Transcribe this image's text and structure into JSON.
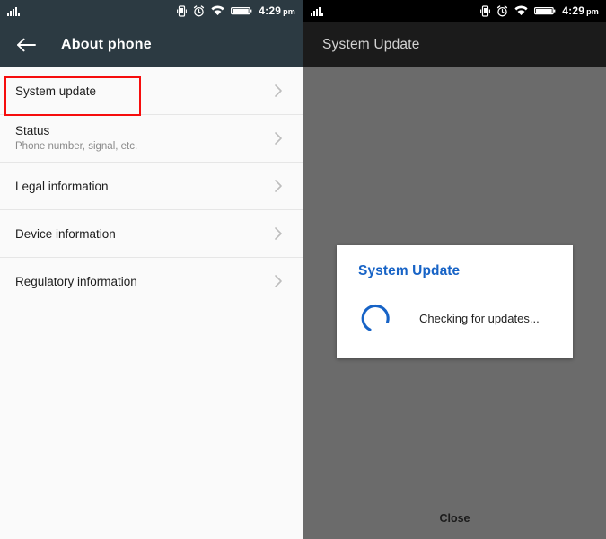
{
  "left_screen": {
    "statusbar": {
      "signal_icon": "signal-bars-icon",
      "vibrate_icon": "vibrate-icon",
      "alarm_icon": "alarm-clock-icon",
      "wifi_icon": "wifi-icon",
      "battery_icon": "battery-full-icon",
      "time": "4:29",
      "ampm": "pm"
    },
    "appbar": {
      "back_icon": "back-arrow-icon",
      "title": "About phone"
    },
    "items": [
      {
        "title": "System update",
        "subtitle": "",
        "chevron": "chevron-right-icon",
        "highlighted": true
      },
      {
        "title": "Status",
        "subtitle": "Phone number, signal, etc.",
        "chevron": "chevron-right-icon",
        "highlighted": false
      },
      {
        "title": "Legal information",
        "subtitle": "",
        "chevron": "chevron-right-icon",
        "highlighted": false
      },
      {
        "title": "Device information",
        "subtitle": "",
        "chevron": "chevron-right-icon",
        "highlighted": false
      },
      {
        "title": "Regulatory information",
        "subtitle": "",
        "chevron": "chevron-right-icon",
        "highlighted": false
      }
    ],
    "highlight_color": "#f60d0d",
    "appbar_color": "#2c3a42"
  },
  "right_screen": {
    "statusbar": {
      "signal_icon": "signal-bars-icon",
      "vibrate_icon": "vibrate-icon",
      "alarm_icon": "alarm-clock-icon",
      "wifi_icon": "wifi-icon",
      "battery_icon": "battery-full-icon",
      "time": "4:29",
      "ampm": "pm"
    },
    "appbar": {
      "title": "System Update"
    },
    "dialog": {
      "title": "System Update",
      "message": "Checking for updates...",
      "spinner_icon": "loading-spinner-icon",
      "accent_color": "#1763c6"
    },
    "close_label": "Close",
    "scrim_color": "#6b6b6b",
    "appbar_color": "#1b1b1b"
  }
}
